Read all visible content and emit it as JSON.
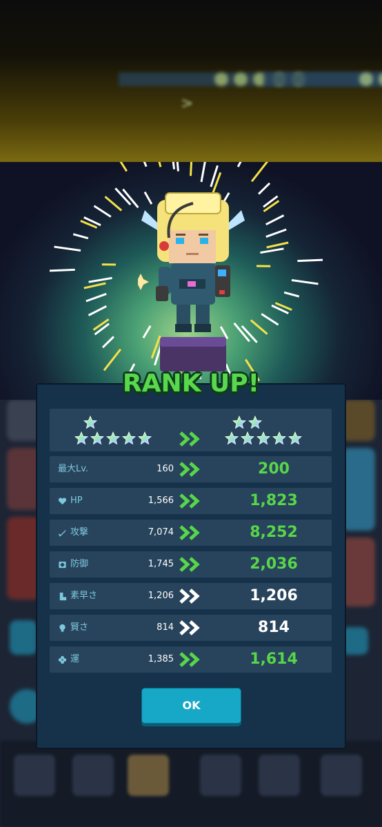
{
  "title": "RANK UP!",
  "rank": {
    "current": {
      "top_stars": 1,
      "base_stars": 5
    },
    "next": {
      "top_stars": 2,
      "base_stars": 5
    }
  },
  "stats": [
    {
      "label": "最大Lv.",
      "icon": "",
      "old": "160",
      "new": "200",
      "increased": true
    },
    {
      "label": "HP",
      "icon": "heart-icon",
      "old": "1,566",
      "new": "1,823",
      "increased": true
    },
    {
      "label": "攻撃",
      "icon": "sword-icon",
      "old": "7,074",
      "new": "8,252",
      "increased": true
    },
    {
      "label": "防御",
      "icon": "shield-icon",
      "old": "1,745",
      "new": "2,036",
      "increased": true
    },
    {
      "label": "素早さ",
      "icon": "boot-icon",
      "old": "1,206",
      "new": "1,206",
      "increased": false
    },
    {
      "label": "賢さ",
      "icon": "bulb-icon",
      "old": "814",
      "new": "814",
      "increased": false
    },
    {
      "label": "運",
      "icon": "clover-icon",
      "old": "1,385",
      "new": "1,614",
      "increased": true
    }
  ],
  "ok_label": "OK",
  "colors": {
    "increase": "#58d64a",
    "unchanged": "#ffffff",
    "accent": "#17a8c8",
    "panel": "#16314a",
    "row": "#28445c"
  }
}
